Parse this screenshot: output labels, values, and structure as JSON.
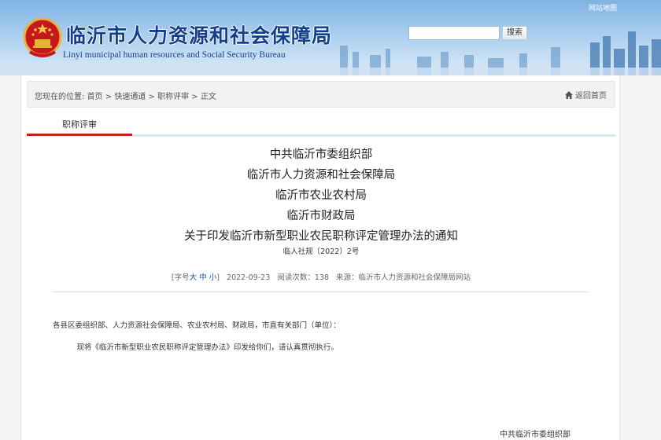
{
  "header": {
    "site_map_link": "网站地图",
    "title_cn": "临沂市人力资源和社会保障局",
    "title_en": "Linyi municipal human resources and Social Security Bureau",
    "search_placeholder": "",
    "search_button": "搜索"
  },
  "breadcrumb": {
    "prefix": "您现在的位置:",
    "items": [
      "首页",
      "快速通道",
      "职称评审",
      "正文"
    ],
    "separator": ">",
    "home_link": "返回首页"
  },
  "tab": {
    "label": "职称评审"
  },
  "document": {
    "issuers": [
      "中共临沂市委组织部",
      "临沂市人力资源和社会保障局",
      "临沂市农业农村局",
      "临沂市财政局"
    ],
    "title": "关于印发临沂市新型职业农民职称评定管理办法的通知",
    "number": "临人社规〔2022〕2号"
  },
  "meta": {
    "font_size_open": "[字号",
    "font_large": "大",
    "font_medium": "中",
    "font_small": "小",
    "font_size_close": "]",
    "date": "2022-09-23",
    "views_label": "阅读次数：",
    "views": "138",
    "source_label": "来源：",
    "source": "临沂市人力资源和社会保障局网站"
  },
  "body": {
    "salutation": "各县区委组织部、人力资源社会保障局、农业农村局、财政局，市直有关部门（单位）：",
    "paragraph": "现将《临沂市新型职业农民职称评定管理办法》印发给你们，请认真贯彻执行。",
    "signature": "中共临沂市委组织部"
  }
}
